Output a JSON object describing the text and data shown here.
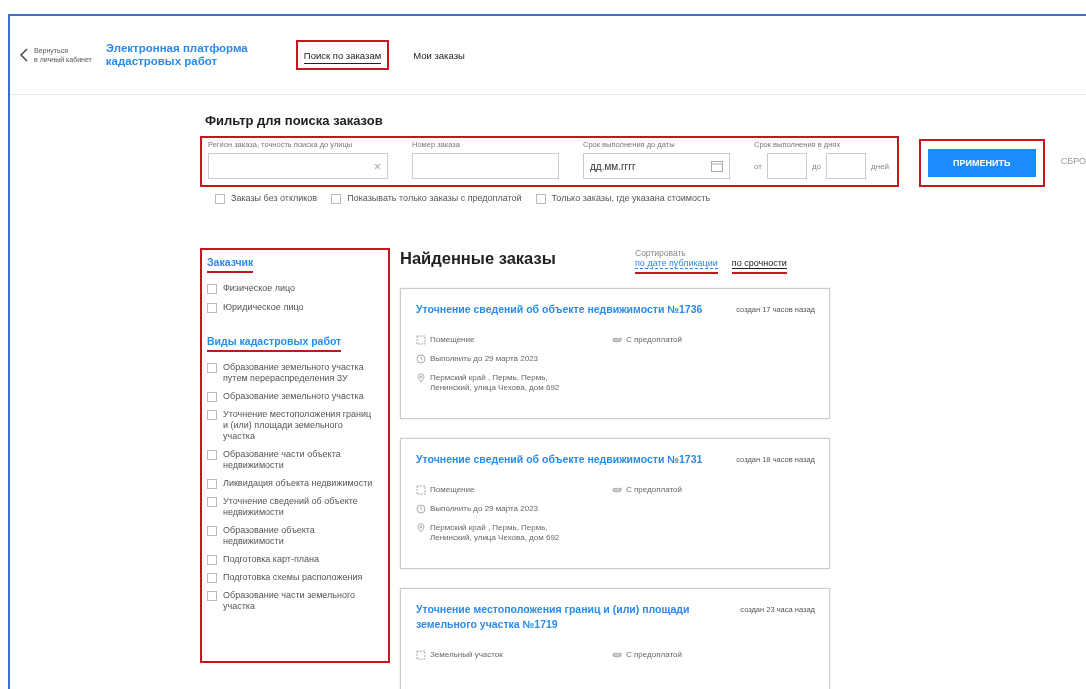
{
  "header": {
    "back_link": [
      "Вернуться",
      "в личный кабинет"
    ],
    "title_lines": [
      "Электронная платформа",
      "кадастровых работ"
    ]
  },
  "nav": [
    {
      "label": "Поиск по заказам",
      "selected": true,
      "highlighted": true
    },
    {
      "label": "Мои заказы",
      "selected": false,
      "highlighted": false
    }
  ],
  "filter": {
    "title": "Фильтр для поиска заказов",
    "highlighted": true,
    "fields": [
      {
        "kind": "text",
        "label": "Регион заказа, точность поиска до улицы",
        "clearable": true
      },
      {
        "kind": "text",
        "label": "Номер заказа",
        "clearable": false
      },
      {
        "kind": "date",
        "label": "Срок выполнения до даты",
        "placeholder": "дд.мм.гггг"
      },
      {
        "kind": "range",
        "label": "Срок выполнения в днях",
        "from_label": "от",
        "to_label": "до",
        "unit": "дней"
      }
    ],
    "apply_button": {
      "label": "ПРИМЕНИТЬ",
      "highlighted": true
    },
    "reset_link": "СБРО",
    "options": [
      {
        "label": "Заказы без откликов",
        "checked": false
      },
      {
        "label": "Показывать только заказы с предоплатой",
        "checked": false
      },
      {
        "label": "Только заказы, где указана стоимость",
        "checked": false
      }
    ]
  },
  "sidebar": {
    "highlighted": true,
    "sections": [
      {
        "title": "Заказчик",
        "highlighted": true,
        "items": [
          {
            "label": "Физическое лицо",
            "checked": false
          },
          {
            "label": "Юридическое лицо",
            "checked": false
          }
        ]
      },
      {
        "title": "Виды кадастровых работ",
        "highlighted": true,
        "items": [
          {
            "label": "Образование земельного участка путем перераспределения ЗУ",
            "checked": false
          },
          {
            "label": "Образование земельного участка",
            "checked": false
          },
          {
            "label": "Уточнение местоположения границ и (или) площади земельного участка",
            "checked": false
          },
          {
            "label": "Образование части объекта недвижимости",
            "checked": false
          },
          {
            "label": "Ликвидация объекта недвижимости",
            "checked": false
          },
          {
            "label": "Уточнение сведений об объекте недвижимости",
            "checked": false
          },
          {
            "label": "Образование объекта недвижимости",
            "checked": false
          },
          {
            "label": "Подготовка карт-плана",
            "checked": false
          },
          {
            "label": "Подготовка схемы расположения",
            "checked": false
          },
          {
            "label": "Образование части земельного участка",
            "checked": false
          }
        ]
      }
    ]
  },
  "results": {
    "title": "Найденные заказы",
    "sort_label": "Сортировать",
    "sort_options": [
      {
        "label": "по дате публикации",
        "selected": true,
        "highlighted": true
      },
      {
        "label": "по срочности",
        "selected": false,
        "highlighted": true
      }
    ],
    "orders": [
      {
        "title": "Уточнение сведений об объекте недвижимости №1736",
        "created": "создан 17 часов назад",
        "property_type": "Помещение",
        "payment": "С предоплатой",
        "deadline": "Выполнить до 29 марта 2023",
        "address_lines": [
          "Пермский край , Пермь, Пермь,",
          "Ленинский, улица Чехова, дом 692"
        ]
      },
      {
        "title": "Уточнение сведений об объекте недвижимости №1731",
        "created": "создан 18 часов назад",
        "property_type": "Помещение",
        "payment": "С предоплатой",
        "deadline": "Выполнить до 29 марта 2023",
        "address_lines": [
          "Пермский край , Пермь, Пермь,",
          "Ленинский, улица Чехова, дом 692"
        ]
      },
      {
        "title": "Уточнение местоположения границ и (или) площади земельного участка №1719",
        "created": "создан 23 часа назад",
        "property_type": "Земельный участок",
        "payment": "С предоплатой"
      }
    ]
  }
}
